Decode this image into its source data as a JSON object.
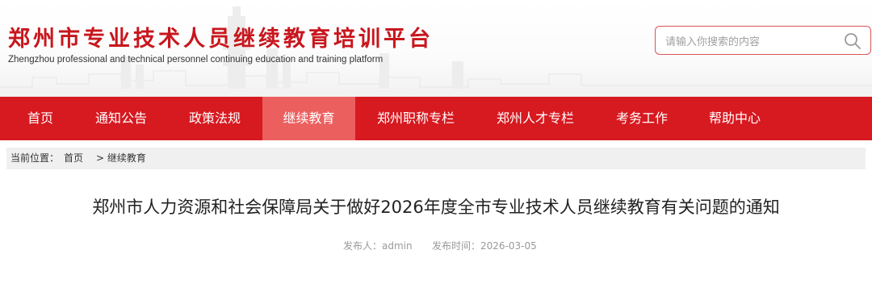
{
  "header": {
    "title": "郑州市专业技术人员继续教育培训平台",
    "subtitle": "Zhengzhou professional and technical personnel continuing education and training platform"
  },
  "search": {
    "placeholder": "请输入你搜索的内容",
    "icon": "search-icon"
  },
  "nav": {
    "items": [
      {
        "label": "首页"
      },
      {
        "label": "通知公告"
      },
      {
        "label": "政策法规"
      },
      {
        "label": "继续教育"
      },
      {
        "label": "郑州职称专栏"
      },
      {
        "label": "郑州人才专栏"
      },
      {
        "label": "考务工作"
      },
      {
        "label": "帮助中心"
      }
    ],
    "active": "继续教育"
  },
  "breadcrumb": {
    "prefix": "当前位置：",
    "home": "首页",
    "current": "> 继续教育"
  },
  "article": {
    "title": "郑州市人力资源和社会保障局关于做好2026年度全市专业技术人员继续教育有关问题的通知",
    "publisher": "发布人：admin",
    "date": "发布时间：2026-03-05"
  },
  "colors": {
    "brand_red": "#d71920",
    "nav_active": "#ec5f5f",
    "logo_red": "#c8161d"
  }
}
